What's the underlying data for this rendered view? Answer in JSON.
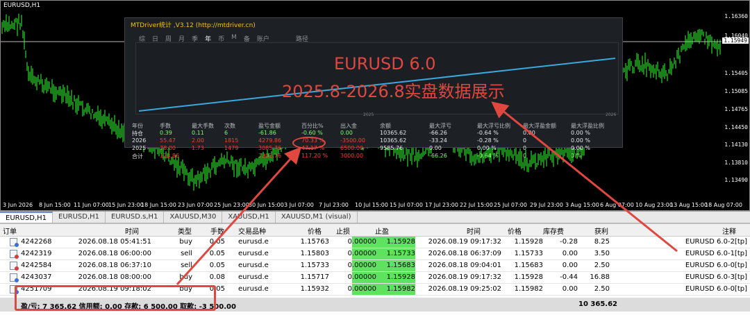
{
  "chart": {
    "symbol_title": "EURUSD,H1",
    "price_labels": [
      "1.16360",
      "1.16040",
      "1.15949",
      "1.15405",
      "1.15085",
      "1.14765",
      "1.14450",
      "1.14130",
      "1.13810",
      "1.13490"
    ],
    "current_price": "1.15949",
    "time_labels": [
      "3 Jun 2026",
      "8 Jun 15:00",
      "11 Jun 07:00",
      "15 Jun 23:00",
      "18 Jun 15:00",
      "23 Jun 07:00",
      "25 Jun 23:00",
      "30 Jun 15:00",
      "3 Jul 07:00",
      "7 Jul 23:00",
      "10 Jul 15:00",
      "15 Jul 07:00",
      "17 Jul 23:00",
      "22 Jul 15:00",
      "25 Jul 07:00",
      "29 Jul 23:00",
      "3 Aug 15:00",
      "6 Aug 07:00",
      "10 Aug 23:00",
      "13 Aug 15:00",
      "18 Aug 07:00"
    ],
    "colors": {
      "candle": "#33ff33",
      "background": "#000000"
    }
  },
  "stats": {
    "title": "MTDriver统计 ,V3.12 (http://mtdriver.cn)",
    "tabs": [
      "综",
      "日",
      "周",
      "月",
      "季",
      "年",
      "币",
      "M",
      "备",
      "账户"
    ],
    "active_tab": "年",
    "path_label": "路径",
    "plot_years": [
      "2025",
      "2026"
    ],
    "overlay_line1": "EURUSD 6.0",
    "overlay_line2": "2025.8-2026.8实盘数据展示",
    "headers": [
      "年份",
      "手数",
      "最大手数",
      "次数",
      "盈亏金额",
      "百分比%",
      "出入金",
      "余额",
      "最大浮亏",
      "最大浮亏比例",
      "最大浮盈金额",
      "最大浮盈比例"
    ],
    "rows": [
      [
        "持仓",
        "0.39",
        "0.11",
        "6",
        "-61.86",
        "-0.60 %",
        "0.00",
        "10365.62",
        "-66.26",
        "-0.64 %",
        "0.00",
        "0.00 %"
      ],
      [
        "2026",
        "55.47",
        "2.00",
        "1815",
        "4279.86",
        "70.33 %",
        "-3500.00",
        "10365.62",
        "-33.24",
        "-0.28 %",
        "0",
        "0.00 %"
      ],
      [
        "2025",
        "78.00",
        "1.73",
        "1479",
        "3085.76",
        "47.17 %",
        "6500.00",
        "9585.76",
        "0.00",
        "0.00 %",
        "0",
        "0.00 %"
      ],
      [
        "合计",
        "133.86",
        "",
        "",
        "7303.76",
        "117.20 %",
        "3000.00",
        "",
        "-66.26",
        "-0.64 %",
        "0",
        "0 %"
      ]
    ]
  },
  "chart_tabs": [
    "EURUSD,H1",
    "EURUSD,H1",
    "EURUSD.s,H1",
    "XAUUSD,M30",
    "XAUUSD,H1",
    "XAUUSD,M1 (visual)"
  ],
  "orders": {
    "headers": [
      "订单",
      "时间",
      "类型",
      "手数",
      "交易品种",
      "价格",
      "止损",
      "止盈",
      "时间",
      "价格",
      "库存费",
      "获利",
      "注释"
    ],
    "rows": [
      {
        "id": "4242268",
        "open_time": "2026.08.18 05:41:51",
        "type": "buy",
        "lots": "0.05",
        "symbol": "eurusd.e",
        "price": "1.15763",
        "sl": "0.00000",
        "tp": "1.15928",
        "close_time": "2026.08.19 09:17:32",
        "close_price": "1.15928",
        "swap": "-0.28",
        "profit": "8.25",
        "comment": "EURUSD 6.0-2[tp]"
      },
      {
        "id": "4242319",
        "open_time": "2026.08.18 06:00:00",
        "type": "sell",
        "lots": "0.05",
        "symbol": "eurusd.e",
        "price": "1.15803",
        "sl": "0.00000",
        "tp": "1.15733",
        "close_time": "2026.08.18 06:37:09",
        "close_price": "1.15733",
        "swap": "0.00",
        "profit": "3.50",
        "comment": "EURUSD 6.0-1[tp]"
      },
      {
        "id": "4242584",
        "open_time": "2026.08.18 06:37:10",
        "type": "sell",
        "lots": "0.05",
        "symbol": "eurusd.e",
        "price": "1.15733",
        "sl": "0.00000",
        "tp": "1.15683",
        "close_time": "2026.08.18 09:04:01",
        "close_price": "1.15683",
        "swap": "0.00",
        "profit": "2.50",
        "comment": "EURUSD 6.0-0[tp]"
      },
      {
        "id": "4243037",
        "open_time": "2026.08.18 08:00:00",
        "type": "buy",
        "lots": "0.08",
        "symbol": "eurusd.e",
        "price": "1.15717",
        "sl": "0.00000",
        "tp": "1.15928",
        "close_time": "2026.08.19 09:17:32",
        "close_price": "1.15928",
        "swap": "-0.44",
        "profit": "16.88",
        "comment": "EURUSD 6.0-3[tp]"
      },
      {
        "id": "4251709",
        "open_time": "2026.08.19 09:18:02",
        "type": "buy",
        "lots": "0.05",
        "symbol": "eurusd.e",
        "price": "1.15932",
        "sl": "0.00000",
        "tp": "1.15982",
        "close_time": "2026.08.19 09:25:02",
        "close_price": "1.15982",
        "swap": "0.00",
        "profit": "2.50",
        "comment": "EURUSD 6.0-0[tp]"
      }
    ],
    "summary_text": "盈/亏: 7 365.62  信用额: 0.00  存款: 6 500.00  取款: -3 500.00",
    "summary_balance": "10 365.62"
  }
}
